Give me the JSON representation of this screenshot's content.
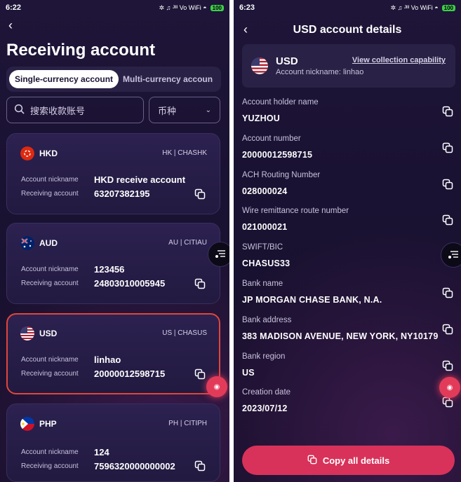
{
  "list_screen": {
    "status": {
      "time": "6:22",
      "icons": "✲ ♫ ᴶᴵᴵᴵ Vo WiFi ◓",
      "battery": "100"
    },
    "title": "Receiving account",
    "tabs": [
      "Single-currency account",
      "Multi-currency accoun"
    ],
    "search": {
      "placeholder": "搜索收款账号"
    },
    "currency_filter": {
      "label": "币种"
    },
    "cards": [
      {
        "currency": "HKD",
        "bank": "HK | CHASHK",
        "nickname_label": "Account nickname",
        "nickname": "HKD receive account",
        "account_label": "Receiving account",
        "account": "63207382195",
        "flag": "hk-flag"
      },
      {
        "currency": "AUD",
        "bank": "AU | CITIAU",
        "nickname_label": "Account nickname",
        "nickname": "123456",
        "account_label": "Receiving account",
        "account": "24803010005945",
        "flag": "au-flag"
      },
      {
        "currency": "USD",
        "bank": "US | CHASUS",
        "nickname_label": "Account nickname",
        "nickname": "linhao",
        "account_label": "Receiving account",
        "account": "20000012598715",
        "flag": "us-flag"
      },
      {
        "currency": "PHP",
        "bank": "PH | CITIPH",
        "nickname_label": "Account nickname",
        "nickname": "124",
        "account_label": "Receiving account",
        "account": "7596320000000002",
        "flag": "ph-flag"
      }
    ],
    "selected_card_index": 2
  },
  "details_screen": {
    "status": {
      "time": "6:23",
      "icons": "✲ ♫ ᴶᴵᴵᴵ Vo WiFi ◓",
      "battery": "100"
    },
    "title": "USD account details",
    "account": {
      "currency": "USD",
      "nickname": "Account nickname: linhao",
      "link": "View collection capability"
    },
    "fields": [
      {
        "label": "Account holder name",
        "value": "YUZHOU"
      },
      {
        "label": "Account number",
        "value": "20000012598715"
      },
      {
        "label": "ACH Routing Number",
        "value": "028000024"
      },
      {
        "label": "Wire remittance route number",
        "value": "021000021"
      },
      {
        "label": "SWIFT/BIC",
        "value": "CHASUS33"
      },
      {
        "label": "Bank name",
        "value": "JP MORGAN CHASE BANK, N.A."
      },
      {
        "label": "Bank address",
        "value": "383 MADISON AVENUE, NEW YORK, NY10179"
      },
      {
        "label": "Bank region",
        "value": "US"
      },
      {
        "label": "Creation date",
        "value": "2023/07/12"
      }
    ],
    "copy_all_label": "Copy all details"
  },
  "colors": {
    "background": "#1a1232",
    "accent": "#d8325a",
    "selected_border": "#e0463c"
  }
}
